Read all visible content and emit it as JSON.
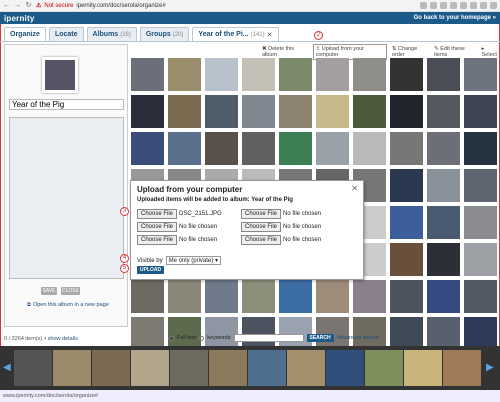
{
  "browser": {
    "warning_icon": "warning-icon",
    "not_secure": "Not secure",
    "url": "ipernity.com/doc/serola/organize#"
  },
  "site": {
    "logo": "ipernity",
    "back_link": "Go back to your homepage »"
  },
  "tabs": [
    {
      "label": "Organize",
      "count": ""
    },
    {
      "label": "Locate",
      "count": ""
    },
    {
      "label": "Albums",
      "count": "(28)"
    },
    {
      "label": "Groups",
      "count": "(20)"
    },
    {
      "label": "Year of the Pi...",
      "count": "(141)"
    }
  ],
  "markers": {
    "m1": "1",
    "m2": "2",
    "m3": "3",
    "m4": "4",
    "m5": "5"
  },
  "album": {
    "title_value": "Year of the Pig",
    "save_label": "SAVE",
    "close_label": "CLOSE",
    "open_link": "Open this album in a new page"
  },
  "toolbar": {
    "delete": "Delete this album",
    "upload": "Upload from your computer",
    "change_order": "Change order",
    "edit_items": "Edit these items",
    "select": "Select"
  },
  "dialog": {
    "title": "Upload from your computer",
    "subtitle": "Uploaded items will be added to album: Year of the Pig",
    "choose_label": "Choose File",
    "files": [
      "DSC_2151.JPG",
      "No file chosen",
      "No file chosen",
      "No file chosen",
      "No file chosen",
      "No file chosen"
    ],
    "visible_label": "Visible by",
    "visible_value": "Me only (private)",
    "upload_label": "UPLOAD"
  },
  "pager": {
    "count": "0 / 3264 item(s)",
    "show_details": "• show details",
    "full_text": "Full text",
    "keywords": "keywords",
    "search_label": "SEARCH",
    "advanced": "Advanced search"
  },
  "status_bar": "www.ipernity.com/doc/serola/organize#",
  "thumb_colors": [
    "#6b6f79",
    "#9a8d6c",
    "#b7c2cc",
    "#c3c0b5",
    "#7a8a6b",
    "#a59ea0",
    "#8f8d88",
    "#333",
    "#4b4e56",
    "#6e7380",
    "#2a2e3a",
    "#7b6b51",
    "#4f5d6b",
    "#7f8790",
    "#8d8370",
    "#c7b98a",
    "#4a5a3b",
    "#20252d",
    "#555a60",
    "#3d4452",
    "#3b4e7a",
    "#5a6f8c",
    "#58514a",
    "#606060",
    "#3d7e54",
    "#9aa0a7",
    "#b8b9bb",
    "#777",
    "#6c6f78",
    "#25323f",
    "#999",
    "#888",
    "#aaa",
    "#bbb",
    "#777",
    "#666",
    "#777",
    "#2a3850",
    "#89929a",
    "#5e6570",
    "#ccc",
    "#ccc",
    "#ccc",
    "#ccc",
    "#ccc",
    "#ccc",
    "#ccc",
    "#3c5f9b",
    "#4a5a70",
    "#8a8b8f",
    "#ccc",
    "#ccc",
    "#ccc",
    "#ccc",
    "#ccc",
    "#ccc",
    "#ccc",
    "#6a4f3a",
    "#2c2f35",
    "#9c9fa3",
    "#6e6a62",
    "#8a8678",
    "#6f7a8a",
    "#8c8f7a",
    "#3c6ea5",
    "#9d8c7a",
    "#8a7f8c",
    "#4d5460",
    "#354a80",
    "#525a66",
    "#7d7a72",
    "#5e6a4e",
    "#8e95a3",
    "#4c5260",
    "#9aa2b0",
    "#7a7570",
    "#6f6b60",
    "#3f4a57",
    "#585f6e",
    "#2d3a5a"
  ],
  "film_colors": [
    "#555",
    "#9b8a6a",
    "#7a6a52",
    "#b1a58c",
    "#6d6a60",
    "#8b7a5c",
    "#4e6f8f",
    "#a38f6c",
    "#2f4f7a",
    "#7d8f5a",
    "#c9b57c",
    "#9e7a56"
  ]
}
